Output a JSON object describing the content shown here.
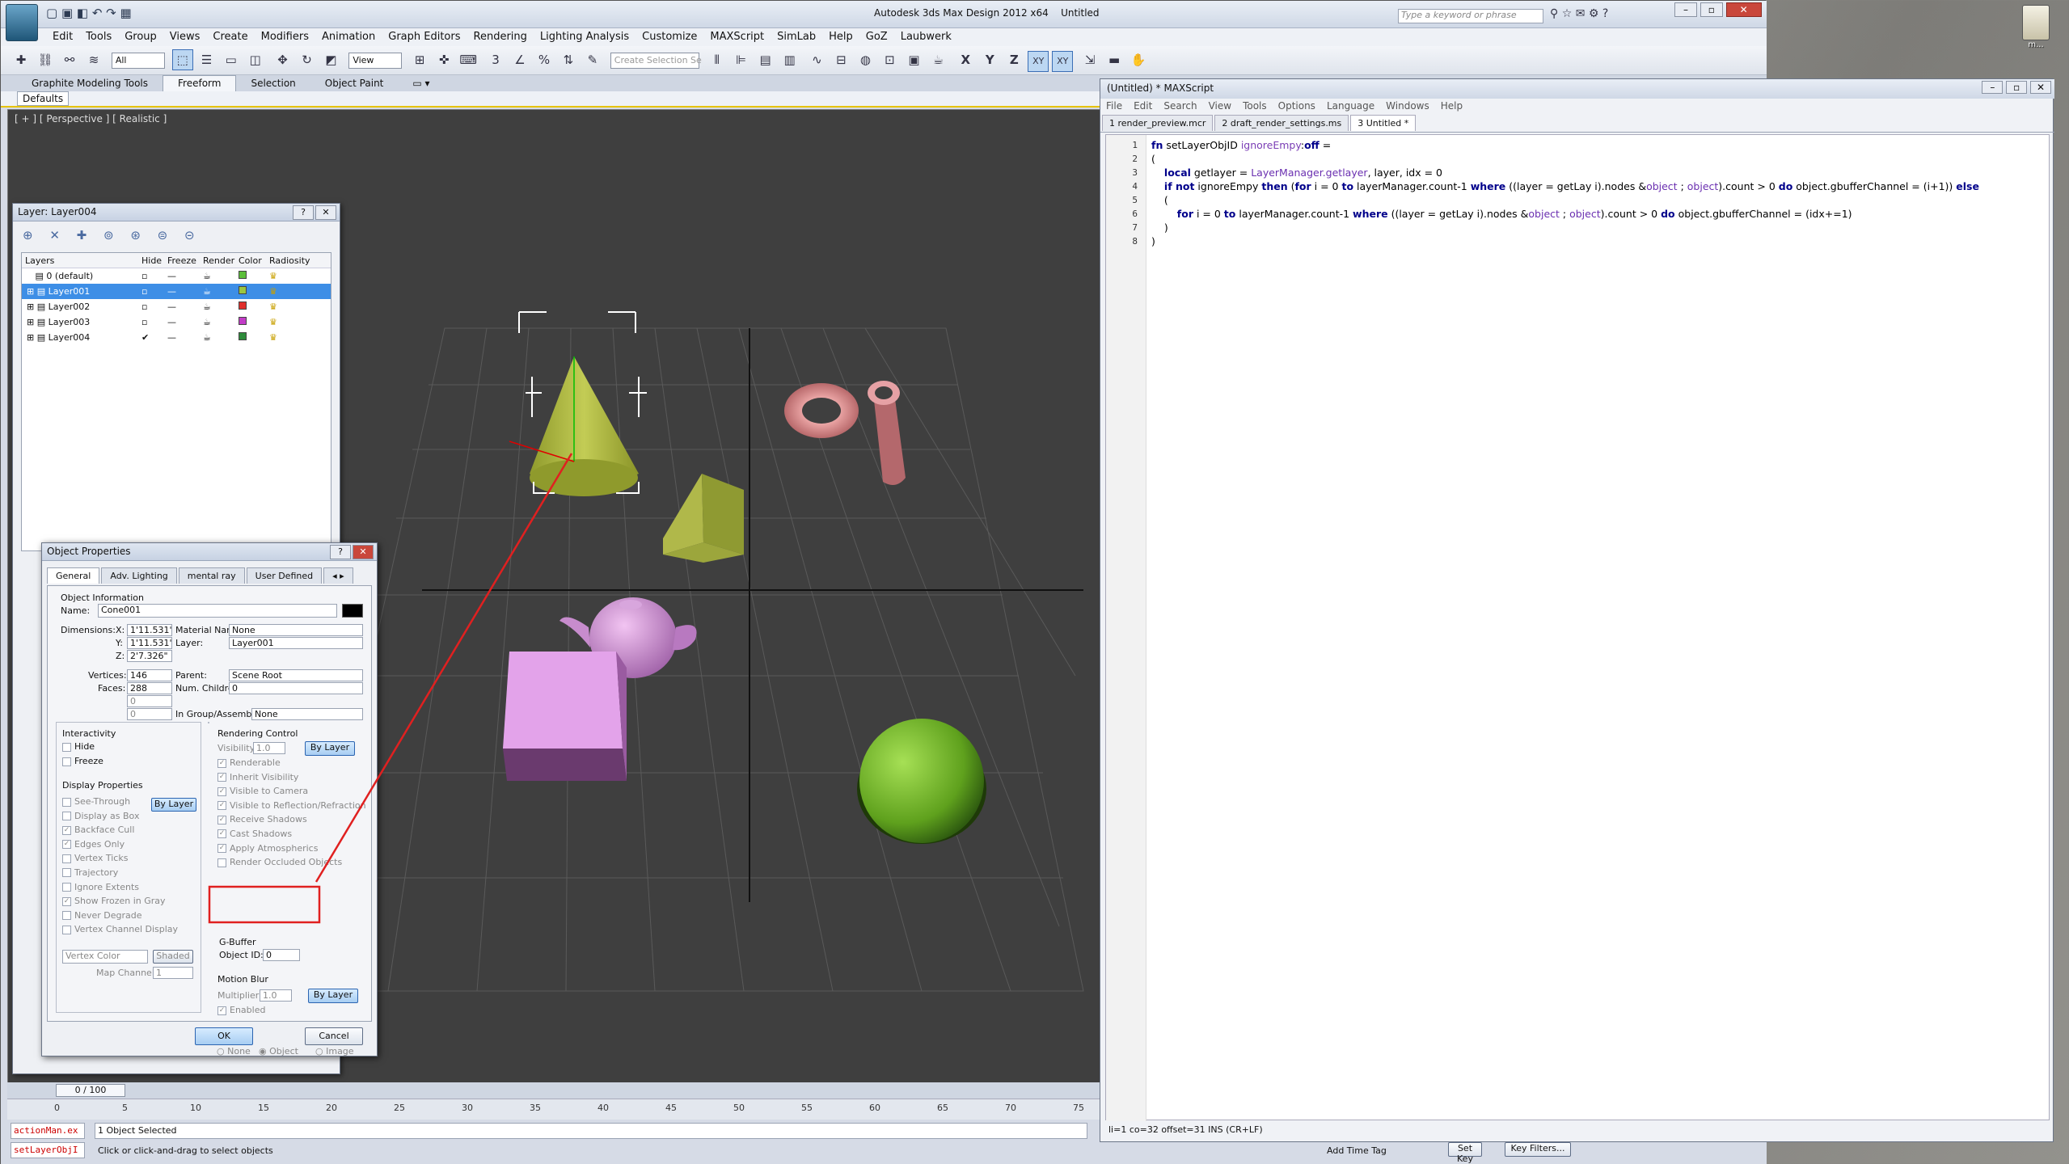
{
  "max_window": {
    "title": "Autodesk 3ds Max Design 2012 x64",
    "file": "Untitled",
    "search_placeholder": "Type a keyword or phrase",
    "menus": [
      "Edit",
      "Tools",
      "Group",
      "Views",
      "Create",
      "Modifiers",
      "Animation",
      "Graph Editors",
      "Rendering",
      "Lighting Analysis",
      "Customize",
      "MAXScript",
      "SimLab",
      "Help",
      "GoZ",
      "Laubwerk"
    ],
    "toolbar": {
      "filter": "All",
      "view": "View",
      "selection_set_placeholder": "Create Selection Se",
      "axes": [
        "X",
        "Y",
        "Z",
        "XY",
        "XY"
      ]
    },
    "ribbon_tabs": [
      "Graphite Modeling Tools",
      "Freeform",
      "Selection",
      "Object Paint"
    ],
    "ribbon_sub": "Defaults",
    "viewport_label": "[ + ] [ Perspective ] [ Realistic ]"
  },
  "layer_dialog": {
    "title": "Layer: Layer004",
    "columns": [
      "Layers",
      "Hide",
      "Freeze",
      "Render",
      "Color",
      "Radiosity"
    ],
    "rows": [
      {
        "name": "0 (default)",
        "color": "#5cbf3a",
        "current": false,
        "selected": false
      },
      {
        "name": "Layer001",
        "color": "#9ac640",
        "current": false,
        "selected": true
      },
      {
        "name": "Layer002",
        "color": "#e0302c",
        "current": false,
        "selected": false
      },
      {
        "name": "Layer003",
        "color": "#c23cc7",
        "current": false,
        "selected": false
      },
      {
        "name": "Layer004",
        "color": "#2e8b3a",
        "current": true,
        "selected": false
      }
    ]
  },
  "object_properties": {
    "title": "Object Properties",
    "tabs": [
      "General",
      "Adv. Lighting",
      "mental ray",
      "User Defined"
    ],
    "object_info_label": "Object Information",
    "name_label": "Name:",
    "name": "Cone001",
    "dimensions_label": "Dimensions:",
    "x_label": "X:",
    "x": "1'11.531\"",
    "y_label": "Y:",
    "y": "1'11.531\"",
    "z_label": "Z:",
    "z": "2'7.326\"",
    "material_name_label": "Material Name:",
    "material_name": "None",
    "layer_label": "Layer:",
    "layer": "Layer001",
    "vertices_label": "Vertices:",
    "vertices": "146",
    "faces_label": "Faces:",
    "faces": "288",
    "parent_label": "Parent:",
    "parent": "Scene Root",
    "num_children_label": "Num. Children:",
    "num_children": "0",
    "extra1": "0",
    "extra2": "0",
    "group_label": "In Group/Assembly:",
    "group": "None",
    "interactivity_label": "Interactivity",
    "hide_label": "Hide",
    "freeze_label": "Freeze",
    "display_props_label": "Display Properties",
    "display_items": [
      "See-Through",
      "Display as Box",
      "Backface Cull",
      "Edges Only",
      "Vertex Ticks",
      "Trajectory",
      "Ignore Extents",
      "Show Frozen in Gray",
      "Never Degrade",
      "Vertex Channel Display"
    ],
    "vertex_color": "Vertex Color",
    "shaded": "Shaded",
    "map_channel_label": "Map Channel:",
    "map_channel": "1",
    "rendering_control_label": "Rendering Control",
    "visibility_label": "Visibility:",
    "visibility": "1.0",
    "rendering_items": [
      "Renderable",
      "Inherit Visibility",
      "Visible to Camera",
      "Visible to Reflection/Refraction",
      "Receive Shadows",
      "Cast Shadows",
      "Apply Atmospherics",
      "Render Occluded Objects"
    ],
    "by_layer": "By Layer",
    "gbuffer_label": "G-Buffer",
    "object_id_label": "Object ID:",
    "object_id": "0",
    "motion_blur_label": "Motion Blur",
    "multiplier_label": "Multiplier:",
    "multiplier": "1.0",
    "enabled_label": "Enabled",
    "blur_none": "None",
    "blur_object": "Object",
    "blur_image": "Image",
    "ok": "OK",
    "cancel": "Cancel"
  },
  "maxscript": {
    "title": "(Untitled) * MAXScript",
    "menus": [
      "File",
      "Edit",
      "Search",
      "View",
      "Tools",
      "Options",
      "Language",
      "Windows",
      "Help"
    ],
    "tabs": [
      "1 render_preview.mcr",
      "2 draft_render_settings.ms",
      "3 Untitled *"
    ],
    "line_numbers": [
      "1",
      "2",
      "3",
      "4",
      "5",
      "6",
      "7",
      "8"
    ],
    "status": "li=1 co=32 offset=31 INS (CR+LF)"
  },
  "bottom": {
    "time": "0 / 100",
    "ruler": [
      "0",
      "5",
      "10",
      "15",
      "20",
      "25",
      "30",
      "35",
      "40",
      "45",
      "50",
      "55",
      "60",
      "65",
      "70",
      "75"
    ],
    "listener1": "actionMan.ex",
    "listener2": "setLayerObjI",
    "status1": "1 Object Selected",
    "status2": "Click or click-and-drag to select objects",
    "add_time_tag": "Add Time Tag",
    "set_key": "Set Key",
    "key_filters": "Key Filters..."
  }
}
